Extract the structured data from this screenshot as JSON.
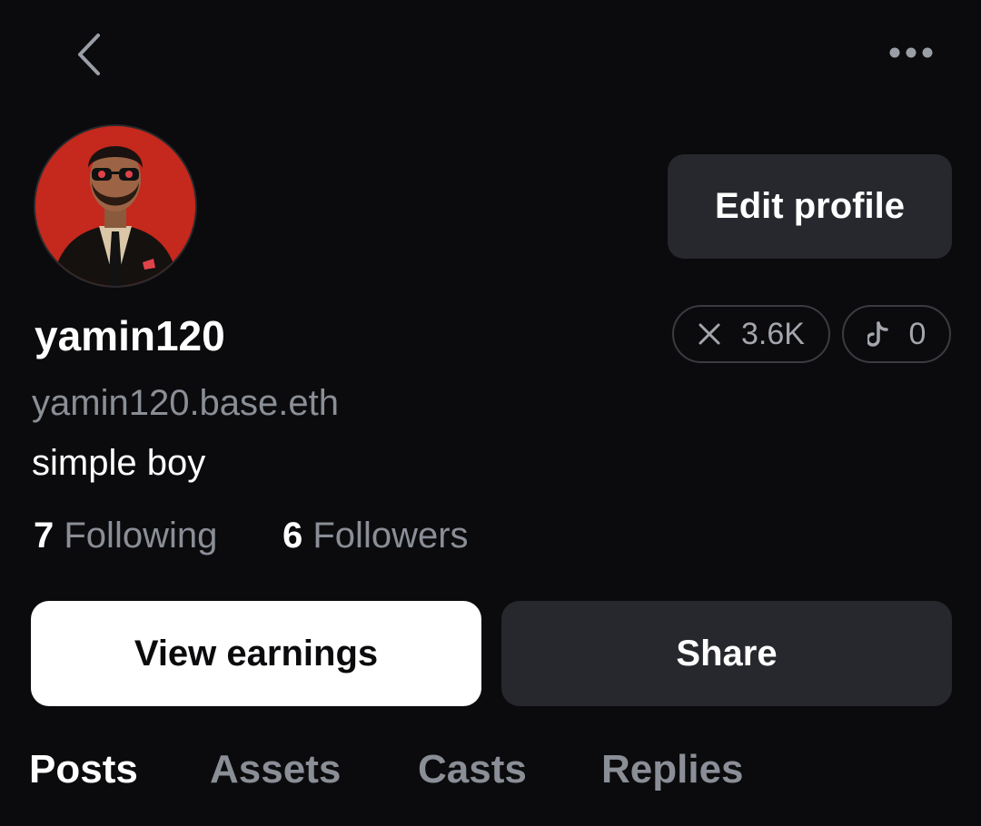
{
  "header": {
    "back_icon": "chevron-left-icon",
    "more_icon": "ellipsis-horizontal-icon"
  },
  "profile": {
    "avatar": "avatar-image",
    "edit_label": "Edit profile",
    "username": "yamin120",
    "handle": "yamin120.base.eth",
    "bio": "simple boy",
    "following_count": "7",
    "following_label": "Following",
    "followers_count": "6",
    "followers_label": "Followers"
  },
  "socials": [
    {
      "icon": "x-logo-icon",
      "value": "3.6K"
    },
    {
      "icon": "tiktok-icon",
      "value": "0"
    }
  ],
  "actions": {
    "earnings_label": "View earnings",
    "share_label": "Share"
  },
  "tabs": [
    {
      "label": "Posts",
      "active": true
    },
    {
      "label": "Assets",
      "active": false
    },
    {
      "label": "Casts",
      "active": false
    },
    {
      "label": "Replies",
      "active": false
    }
  ],
  "colors": {
    "background": "#0b0b0d",
    "button_dark": "#26282d",
    "muted_text": "#8a8e96",
    "avatar_bg": "#c5281c"
  }
}
